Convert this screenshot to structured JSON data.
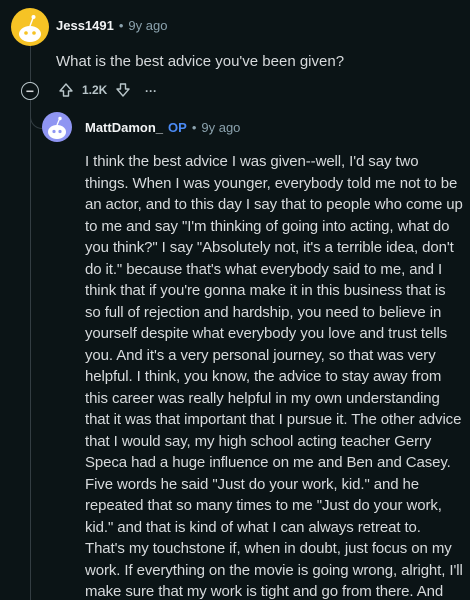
{
  "parent_comment": {
    "username": "Jess1491",
    "separator": "•",
    "age": "9y ago",
    "text": "What is the best advice you've been given?",
    "score": "1.2K",
    "more": "···",
    "collapse_symbol": "−"
  },
  "reply": {
    "username": "MattDamon_",
    "op_badge": "OP",
    "separator": "•",
    "age": "9y ago",
    "text": "I think the best advice I was given--well, I'd say two things. When I was younger, everybody told me not to be an actor, and to this day I say that to people who come up to me and say \"I'm thinking of going into acting, what do you think?\" I say \"Absolutely not, it's a terrible idea, don't do it.\" because that's what everybody said to me, and I think that if you're gonna make it in this business that is so full of rejection and hardship, you need to believe in yourself despite what everybody you love and trust tells you. And it's a very personal journey, so that was very helpful. I think, you know, the advice to stay away from this career was really helpful in my own understanding that it was that important that I pursue it. The other advice that I would say, my high school acting teacher Gerry Speca had a huge influence on me and Ben and Casey. Five words he said \"Just do your work, kid.\" and he repeated that so many times to me \"Just do your work, kid.\" and that is kind of what I can always retreat to. That's my touchstone if, when in doubt, just focus on my work. If everything on the movie is going wrong, alright, I'll make sure that my work is tight and go from there. And that's a great place to base from, and that's a good foundation."
  },
  "colors": {
    "background": "#0b1416",
    "op_badge": "#4b8bf5",
    "avatar1": "#f6c325",
    "avatar2": "#8f95f2"
  }
}
